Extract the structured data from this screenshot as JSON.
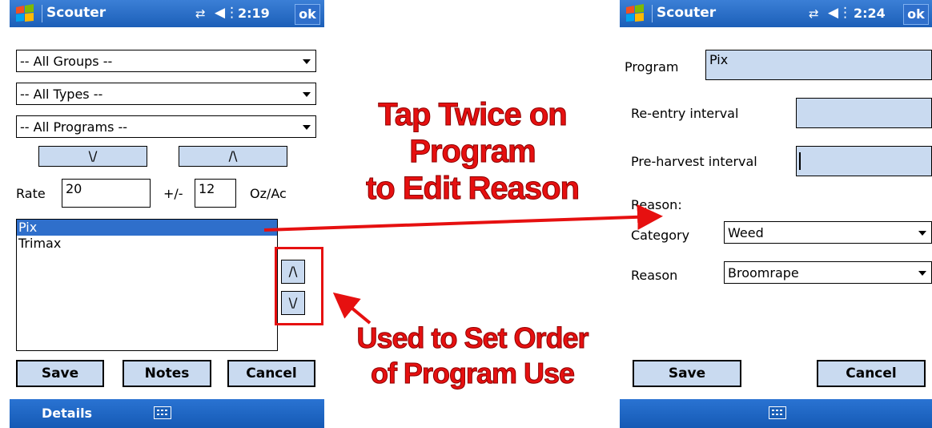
{
  "left_screen": {
    "title": "Scouter",
    "clock": "2:19",
    "ok_label": "ok",
    "groups_dropdown": "-- All Groups --",
    "types_dropdown": "-- All Types --",
    "programs_dropdown": "-- All Programs --",
    "sort_down_label": "\\/",
    "sort_up_label": "/\\",
    "rate_label": "Rate",
    "rate_value": "20",
    "plusminus_label": "+/-",
    "tolerance_value": "12",
    "unit_label": "Oz/Ac",
    "program_list": [
      "Pix",
      "Trimax"
    ],
    "selected_index": 0,
    "move_up_label": "/\\",
    "move_down_label": "\\/",
    "save_label": "Save",
    "notes_label": "Notes",
    "cancel_label": "Cancel",
    "menu_details": "Details"
  },
  "right_screen": {
    "title": "Scouter",
    "clock": "2:24",
    "ok_label": "ok",
    "program_label": "Program",
    "program_value": "Pix",
    "reentry_label": "Re-entry interval",
    "reentry_value": "",
    "preharvest_label": "Pre-harvest interval",
    "preharvest_value": "",
    "reason_header": "Reason:",
    "category_label": "Category",
    "category_value": "Weed",
    "reason_label": "Reason",
    "reason_value": "Broomrape",
    "save_label": "Save",
    "cancel_label": "Cancel"
  },
  "annotations": {
    "tap_line1": "Tap Twice on Program",
    "tap_line2": "to Edit Reason",
    "order_line1": "Used to Set Order",
    "order_line2": "of Program Use"
  },
  "colors": {
    "annotation_red": "#e61010",
    "titlebar_blue": "#1c5fb8",
    "control_fill": "#c9daf0",
    "selection_blue": "#2f6fcb"
  }
}
